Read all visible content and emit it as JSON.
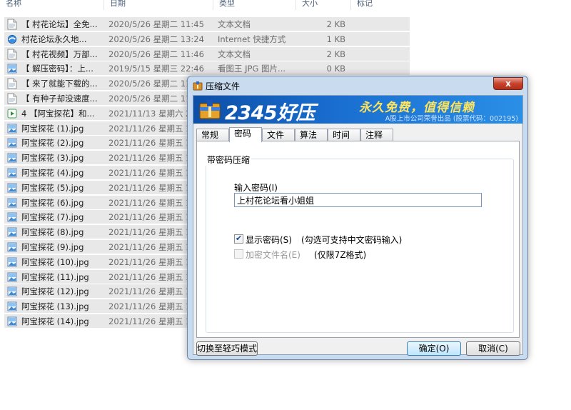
{
  "explorer": {
    "columns": {
      "name": "名称",
      "date": "日期",
      "type": "类型",
      "size": "大小",
      "tags": "标记"
    },
    "files": [
      {
        "name": "【 村花论坛】全免...",
        "date": "2020/5/26 星期二 11:45",
        "type": "文本文档",
        "size": "2 KB",
        "icon": "text-file-icon"
      },
      {
        "name": "村花论坛永久地...",
        "date": "2020/5/26 星期二 13:24",
        "type": "Internet 快捷方式",
        "size": "1 KB",
        "icon": "internet-shortcut-icon"
      },
      {
        "name": "【 村花视频】万部...",
        "date": "2020/5/26 星期二 11:46",
        "type": "文本文档",
        "size": "2 KB",
        "icon": "text-file-icon"
      },
      {
        "name": "【 解压密码】：上...",
        "date": "2019/5/15 星期三 22:46",
        "type": "看图王 JPG 图片...",
        "size": "0 KB",
        "icon": "image-file-icon"
      },
      {
        "name": "【 来了就能下载的...",
        "date": "2020/5/26 星期二 11",
        "type": "",
        "size": "",
        "icon": "text-file-icon"
      },
      {
        "name": "【 有种子却没速度...",
        "date": "2020/5/26 星期二 11",
        "type": "",
        "size": "",
        "icon": "text-file-icon"
      },
      {
        "name": "4 【阿宝探花】和...",
        "date": "2021/11/13 星期六 2",
        "type": "",
        "size": "",
        "icon": "video-file-icon"
      },
      {
        "name": "阿宝探花 (1).jpg",
        "date": "2021/11/26 星期五 1",
        "type": "",
        "size": "",
        "icon": "image-file-icon"
      },
      {
        "name": "阿宝探花 (2).jpg",
        "date": "2021/11/26 星期五 1",
        "type": "",
        "size": "",
        "icon": "image-file-icon"
      },
      {
        "name": "阿宝探花 (3).jpg",
        "date": "2021/11/26 星期五 1",
        "type": "",
        "size": "",
        "icon": "image-file-icon"
      },
      {
        "name": "阿宝探花 (4).jpg",
        "date": "2021/11/26 星期五 1",
        "type": "",
        "size": "",
        "icon": "image-file-icon"
      },
      {
        "name": "阿宝探花 (5).jpg",
        "date": "2021/11/26 星期五 1",
        "type": "",
        "size": "",
        "icon": "image-file-icon"
      },
      {
        "name": "阿宝探花 (6).jpg",
        "date": "2021/11/26 星期五 1",
        "type": "",
        "size": "",
        "icon": "image-file-icon"
      },
      {
        "name": "阿宝探花 (7).jpg",
        "date": "2021/11/26 星期五 1",
        "type": "",
        "size": "",
        "icon": "image-file-icon"
      },
      {
        "name": "阿宝探花 (8).jpg",
        "date": "2021/11/26 星期五 1",
        "type": "",
        "size": "",
        "icon": "image-file-icon"
      },
      {
        "name": "阿宝探花 (9).jpg",
        "date": "2021/11/26 星期五 1",
        "type": "",
        "size": "",
        "icon": "image-file-icon"
      },
      {
        "name": "阿宝探花 (10).jpg",
        "date": "2021/11/26 星期五 1",
        "type": "",
        "size": "",
        "icon": "image-file-icon"
      },
      {
        "name": "阿宝探花 (11).jpg",
        "date": "2021/11/26 星期五 1",
        "type": "",
        "size": "",
        "icon": "image-file-icon"
      },
      {
        "name": "阿宝探花 (12).jpg",
        "date": "2021/11/26 星期五 1",
        "type": "",
        "size": "",
        "icon": "image-file-icon"
      },
      {
        "name": "阿宝探花 (13).jpg",
        "date": "2021/11/26 星期五 1",
        "type": "",
        "size": "",
        "icon": "image-file-icon"
      },
      {
        "name": "阿宝探花 (14).jpg",
        "date": "2021/11/26 星期五 1",
        "type": "",
        "size": "",
        "icon": "image-file-icon"
      }
    ]
  },
  "dialog": {
    "title": "压缩文件",
    "close_label": "x",
    "banner": {
      "brand": "2345好压",
      "slogan": "永久免费，值得信赖",
      "sub": "A股上市公司荣誉出品 (股票代码：002195)"
    },
    "tabs": [
      "常规",
      "密码",
      "文件",
      "算法",
      "时间",
      "注释"
    ],
    "active_tab": "密码",
    "group_title": "带密码压缩",
    "password_label": "输入密码(I)",
    "password_value": "上村花论坛看小姐姐",
    "show_password": {
      "label": "显示密码(S)",
      "note": "(勾选可支持中文密码输入)",
      "checked": true
    },
    "encrypt_names": {
      "label": "加密文件名(E)",
      "note": "(仅限7Z格式)",
      "checked": false,
      "disabled": true
    },
    "switch_mode_label": "切换至轻巧模式",
    "ok_label": "确定(O)",
    "cancel_label": "取消(C)"
  },
  "colors": {
    "banner_blue": "#1a6fd0",
    "slogan_yellow": "#ffe45c",
    "close_red": "#c7432d",
    "row_gray": "#e8e8e8"
  }
}
